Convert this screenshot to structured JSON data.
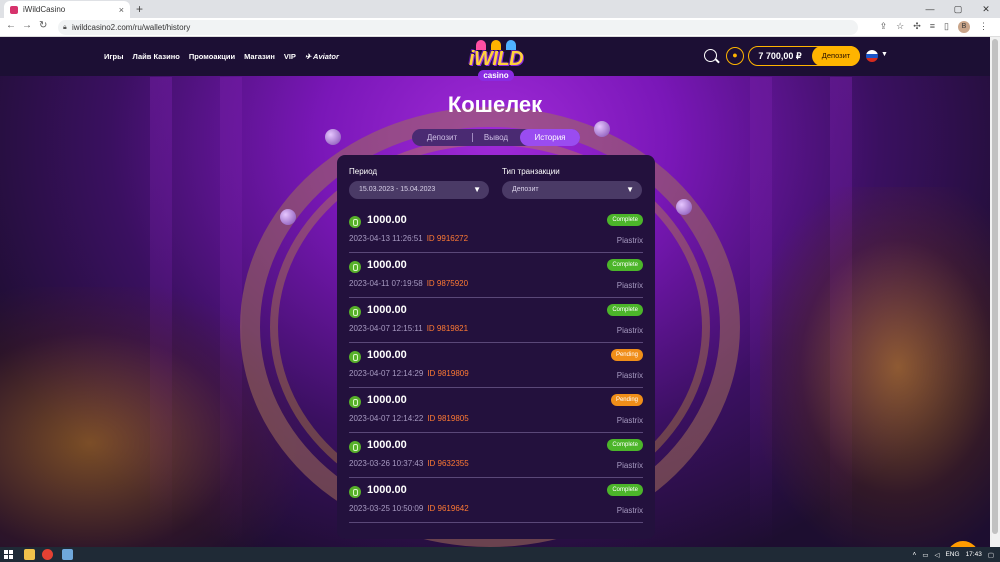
{
  "browser": {
    "tab_title": "iWildCasino",
    "tab_close": "×",
    "new_tab": "+",
    "window_controls": [
      "—",
      "▢",
      "✕"
    ],
    "url": "iwildcasino2.com/ru/wallet/history",
    "profile_initial": "В"
  },
  "header": {
    "menu": [
      "Игры",
      "Лайв Казино",
      "Промоакции",
      "Магазин",
      "VIP"
    ],
    "aviator": "Aviator",
    "logo_word": "iWILD",
    "logo_sub": "casino",
    "balance": "7 700,00 ₽",
    "deposit_button": "Депозит"
  },
  "wallet": {
    "title": "Кошелек",
    "tabs": [
      "Депозит",
      "Вывод",
      "История"
    ],
    "active_tab": "История",
    "period_label": "Период",
    "period_value": "15.03.2023  -  15.04.2023",
    "type_label": "Тип транзакции",
    "type_value": "Депозит",
    "transactions": [
      {
        "amount": "1000.00",
        "datetime": "2023-04-13 11:26:51",
        "id": "ID 9916272",
        "status": "Complete",
        "method": "Piastrix"
      },
      {
        "amount": "1000.00",
        "datetime": "2023-04-11 07:19:58",
        "id": "ID 9875920",
        "status": "Complete",
        "method": "Piastrix"
      },
      {
        "amount": "1000.00",
        "datetime": "2023-04-07 12:15:11",
        "id": "ID 9819821",
        "status": "Complete",
        "method": "Piastrix"
      },
      {
        "amount": "1000.00",
        "datetime": "2023-04-07 12:14:29",
        "id": "ID 9819809",
        "status": "Pending",
        "method": "Piastrix"
      },
      {
        "amount": "1000.00",
        "datetime": "2023-04-07 12:14:22",
        "id": "ID 9819805",
        "status": "Pending",
        "method": "Piastrix"
      },
      {
        "amount": "1000.00",
        "datetime": "2023-03-26 10:37:43",
        "id": "ID 9632355",
        "status": "Complete",
        "method": "Piastrix"
      },
      {
        "amount": "1000.00",
        "datetime": "2023-03-25 10:50:09",
        "id": "ID 9619642",
        "status": "Complete",
        "method": "Piastrix"
      }
    ]
  },
  "taskbar": {
    "language": "ENG",
    "time": "17:43"
  },
  "colors": {
    "accent": "#ffb400",
    "active_tab": "#9a4cf0",
    "complete": "#4cb52a",
    "pending": "#f08e19",
    "transaction_id": "#ff7a33"
  }
}
